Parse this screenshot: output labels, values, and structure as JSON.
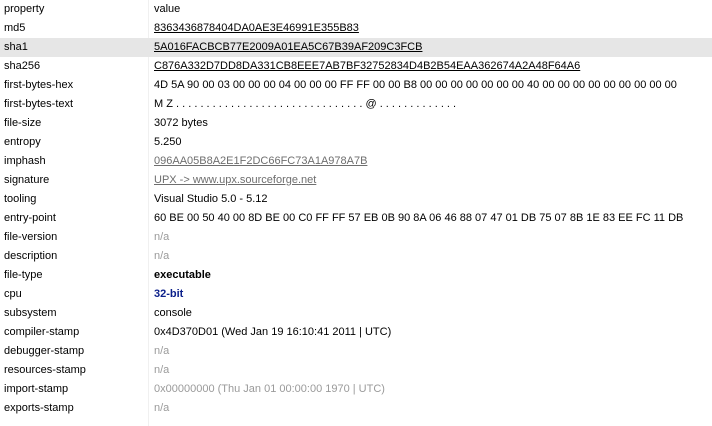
{
  "columns": {
    "property": "property",
    "value": "value"
  },
  "rows": [
    {
      "key": "md5",
      "value": "8363436878404DA0AE3E46991E355B83",
      "style": "link"
    },
    {
      "key": "sha1",
      "value": "5A016FACBCB77E2009A01EA5C67B39AF209C3FCB",
      "style": "link",
      "selected": true
    },
    {
      "key": "sha256",
      "value": "C876A332D7DD8DA331CB8EEE7AB7BF32752834D4B2B54EAA362674A2A48F64A6",
      "style": "link"
    },
    {
      "key": "first-bytes-hex",
      "value": "4D 5A 90 00 03 00 00 00 04 00 00 00 FF FF 00 00 B8 00 00 00 00 00 00 00 40 00 00 00 00 00 00 00 00 00",
      "style": "plain"
    },
    {
      "key": "first-bytes-text",
      "value": "M Z . . . . . . . . . . . . . . . . . . . . . . . . . . . . . . . @ . . . . . . . . . . . . .",
      "style": "plain"
    },
    {
      "key": "file-size",
      "value": "3072 bytes",
      "style": "plain"
    },
    {
      "key": "entropy",
      "value": "5.250",
      "style": "plain"
    },
    {
      "key": "imphash",
      "value": "096AA05B8A2E1F2DC66FC73A1A978A7B",
      "style": "link-gray"
    },
    {
      "key": "signature",
      "value": "UPX -> www.upx.sourceforge.net",
      "style": "link-gray"
    },
    {
      "key": "tooling",
      "value": "Visual Studio 5.0 - 5.12",
      "style": "plain"
    },
    {
      "key": "entry-point",
      "value": "60 BE 00 50 40 00 8D BE 00 C0 FF FF 57 EB 0B 90 8A 06 46 88 07 47 01 DB 75 07 8B 1E 83 EE FC 11 DB",
      "style": "plain"
    },
    {
      "key": "file-version",
      "value": "n/a",
      "style": "na"
    },
    {
      "key": "description",
      "value": "n/a",
      "style": "na"
    },
    {
      "key": "file-type",
      "value": "executable",
      "style": "bold"
    },
    {
      "key": "cpu",
      "value": "32-bit",
      "style": "blue"
    },
    {
      "key": "subsystem",
      "value": "console",
      "style": "plain"
    },
    {
      "key": "compiler-stamp",
      "value": "0x4D370D01 (Wed Jan 19 16:10:41 2011 | UTC)",
      "style": "plain"
    },
    {
      "key": "debugger-stamp",
      "value": "n/a",
      "style": "na"
    },
    {
      "key": "resources-stamp",
      "value": "n/a",
      "style": "na"
    },
    {
      "key": "import-stamp",
      "value": "0x00000000 (Thu Jan 01 00:00:00 1970 | UTC)",
      "style": "na"
    },
    {
      "key": "exports-stamp",
      "value": "n/a",
      "style": "na"
    }
  ]
}
